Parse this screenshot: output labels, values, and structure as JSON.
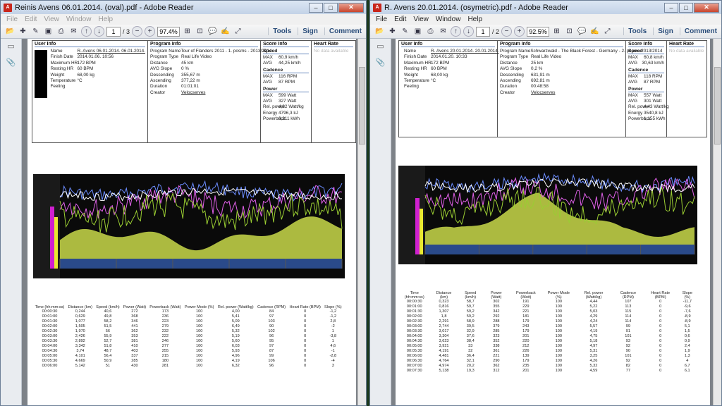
{
  "colors": {
    "chart_bg": "#0a0a0a",
    "altitude_fill": "#c9d94a",
    "power_line": "#9acd32",
    "speed_line": "#6b8cff",
    "cadence_line": "#e060e8",
    "hr_line": "#ffffff"
  },
  "left": {
    "title": "Reinis Avens 06.01.2014. (oval).pdf - Adobe Reader",
    "menu": [
      "File",
      "Edit",
      "View",
      "Window",
      "Help"
    ],
    "page_current": "1",
    "page_total": "/ 3",
    "zoom": "97.4%",
    "tools": [
      "Tools",
      "Sign",
      "Comment"
    ],
    "user": {
      "header": "User Info",
      "rows": [
        {
          "k": "Name",
          "v": "R. Avens 06.01.2014. 06.01.2014."
        },
        {
          "k": "Finish Date",
          "v": "2014.01.06. 10:56"
        },
        {
          "k": "Maximum HR",
          "v": "172 BPM"
        },
        {
          "k": "Resting HR",
          "v": "60 BPM"
        },
        {
          "k": "Weight",
          "v": "68,00 kg"
        },
        {
          "k": "Temperature",
          "v": "°C"
        },
        {
          "k": "Feeling",
          "v": ""
        }
      ]
    },
    "program": {
      "header": "Program Info",
      "rows": [
        {
          "k": "Program Name",
          "v": "Tour of Flanders 2011 - 1. posms - 2013/2014"
        },
        {
          "k": "Program Type",
          "v": "Real Life Video"
        },
        {
          "k": "Distance",
          "v": "45 km"
        },
        {
          "k": "AVG Slope",
          "v": "0 %"
        },
        {
          "k": "Descending",
          "v": "355,67 m"
        },
        {
          "k": "Ascending",
          "v": "377,22 m"
        },
        {
          "k": "Duration",
          "v": "01:01:01"
        },
        {
          "k": "",
          "v": ""
        },
        {
          "k": "Creator",
          "v": "Velocserves"
        }
      ]
    },
    "score": {
      "header": "Score Info",
      "speed_hdr": "Speed",
      "speed": [
        {
          "k": "MAX",
          "v": "60,9 km/h"
        },
        {
          "k": "AVG",
          "v": "44,25 km/h"
        }
      ],
      "cadence_hdr": "Cadence",
      "cadence": [
        {
          "k": "MAX",
          "v": "116 RPM"
        },
        {
          "k": "AVG",
          "v": "87 RPM"
        }
      ],
      "power_hdr": "Power",
      "power": [
        {
          "k": "MAX",
          "v": "599 Watt"
        },
        {
          "k": "AVG",
          "v": "327 Watt"
        },
        {
          "k": "Rel. power",
          "v": "4,82 Watt/kg"
        },
        {
          "k": "Energy",
          "v": "4796,3 kJ"
        },
        {
          "k": "Powerback",
          "v": "0,211 kWh"
        }
      ]
    },
    "heart": {
      "header": "Heart Rate",
      "faint": "No data available"
    },
    "table": {
      "headers": [
        "Time (hh:mm:ss)",
        "Distance (km)",
        "Speed (km/h)",
        "Power (Watt)",
        "Powerback (Watt)",
        "Power Mode (%)",
        "Rel. power (Watt/kg)",
        "Cadence (RPM)",
        "Heart Rate (BPM)",
        "Slope (%)"
      ],
      "rows": [
        [
          "00:00:30",
          "0,244",
          "40,6",
          "272",
          "173",
          "100",
          "4,00",
          "84",
          "0",
          "-1,2"
        ],
        [
          "00:01:00",
          "0,629",
          "49,8",
          "368",
          "236",
          "100",
          "5,41",
          "97",
          "0",
          "-1,2"
        ],
        [
          "00:01:30",
          "1,077",
          "58,2",
          "346",
          "223",
          "100",
          "5,09",
          "103",
          "0",
          "2,8"
        ],
        [
          "00:02:00",
          "1,505",
          "51,5",
          "441",
          "279",
          "100",
          "6,49",
          "90",
          "0",
          "-2"
        ],
        [
          "00:02:30",
          "1,970",
          "56",
          "362",
          "232",
          "100",
          "5,32",
          "102",
          "0",
          "1"
        ],
        [
          "00:03:00",
          "2,426",
          "55,9",
          "353",
          "222",
          "100",
          "5,19",
          "96",
          "0",
          "-3,8"
        ],
        [
          "00:03:30",
          "2,892",
          "52,7",
          "381",
          "246",
          "100",
          "5,60",
          "95",
          "0",
          "1"
        ],
        [
          "00:04:00",
          "3,342",
          "51,8",
          "410",
          "277",
          "100",
          "6,03",
          "97",
          "0",
          "4,6"
        ],
        [
          "00:04:30",
          "3,74",
          "48,7",
          "403",
          "255",
          "100",
          "5,93",
          "87",
          "0",
          "-1"
        ],
        [
          "00:05:00",
          "4,101",
          "56,4",
          "337",
          "215",
          "100",
          "4,96",
          "99",
          "0",
          "-2,8"
        ],
        [
          "00:05:30",
          "4,669",
          "50,9",
          "285",
          "180",
          "100",
          "4,19",
          "106",
          "0",
          "-4"
        ],
        [
          "00:06:00",
          "5,142",
          "51",
          "430",
          "281",
          "100",
          "6,32",
          "96",
          "0",
          "3"
        ]
      ]
    }
  },
  "right": {
    "title": "R. Avens 20.01.2014. (osymetric).pdf - Adobe Reader",
    "menu": [
      "File",
      "Edit",
      "View",
      "Window",
      "Help"
    ],
    "page_current": "1",
    "page_total": "/ 2",
    "zoom": "92.5%",
    "tools": [
      "Tools",
      "Sign",
      "Comment"
    ],
    "user": {
      "header": "User Info",
      "rows": [
        {
          "k": "Name",
          "v": "R. Avens 20.01.2014. 20.01.2014."
        },
        {
          "k": "Finish Date",
          "v": "2014.01.20. 10:33"
        },
        {
          "k": "Maximum HR",
          "v": "172 BPM"
        },
        {
          "k": "Resting HR",
          "v": "60 BPM"
        },
        {
          "k": "Weight",
          "v": "68,00 kg"
        },
        {
          "k": "Temperature",
          "v": "°C"
        },
        {
          "k": "Feeling",
          "v": ""
        }
      ]
    },
    "program": {
      "header": "Program Info",
      "rows": [
        {
          "k": "Program Name",
          "v": "Schwarzwald - The Black Forest - Germany - 2. posms 2013/2014"
        },
        {
          "k": "Program Type",
          "v": "Real Life Video"
        },
        {
          "k": "Distance",
          "v": "25 km"
        },
        {
          "k": "AVG Slope",
          "v": "0,2 %"
        },
        {
          "k": "Descending",
          "v": "631,91 m"
        },
        {
          "k": "Ascending",
          "v": "692,81 m"
        },
        {
          "k": "Duration",
          "v": "00:48:58"
        },
        {
          "k": "",
          "v": ""
        },
        {
          "k": "Creator",
          "v": "Velocserves"
        }
      ]
    },
    "score": {
      "header": "Score Info",
      "speed_hdr": "Speed",
      "speed": [
        {
          "k": "MAX",
          "v": "60,8 km/h"
        },
        {
          "k": "AVG",
          "v": "30,63 km/h"
        }
      ],
      "cadence_hdr": "Cadence",
      "cadence": [
        {
          "k": "MAX",
          "v": "118 RPM"
        },
        {
          "k": "AVG",
          "v": "87 RPM"
        }
      ],
      "power_hdr": "Power",
      "power": [
        {
          "k": "MAX",
          "v": "557 Watt"
        },
        {
          "k": "AVG",
          "v": "301 Watt"
        },
        {
          "k": "Rel. power",
          "v": "4,43 Watt/kg"
        },
        {
          "k": "Energy",
          "v": "3540,8 kJ"
        },
        {
          "k": "Powerback",
          "v": "1,155 kWh"
        }
      ]
    },
    "heart": {
      "header": "Heart Rate",
      "faint": "No data available"
    },
    "table": {
      "headers": [
        "Time (hh:mm:ss)",
        "Distance (km)",
        "Speed (km/h)",
        "Power (Watt)",
        "Powerback (Watt)",
        "Power Mode (%)",
        "Rel. power (Watt/kg)",
        "Cadence (RPM)",
        "Heart Rate (BPM)",
        "Slope (%)"
      ],
      "rows": [
        [
          "00:00:30",
          "0,323",
          "58,7",
          "302",
          "191",
          "100",
          "4,44",
          "107",
          "0",
          "-11,7"
        ],
        [
          "00:01:00",
          "0,816",
          "59,7",
          "355",
          "229",
          "100",
          "5,22",
          "113",
          "0",
          "-9,6"
        ],
        [
          "00:01:30",
          "1,307",
          "59,2",
          "342",
          "221",
          "100",
          "5,03",
          "115",
          "0",
          "-7,6"
        ],
        [
          "00:02:00",
          "1,8",
          "59,2",
          "292",
          "181",
          "100",
          "4,29",
          "114",
          "0",
          "-8,9"
        ],
        [
          "00:02:30",
          "2,291",
          "58,9",
          "288",
          "179",
          "100",
          "4,24",
          "114",
          "0",
          "-8,9"
        ],
        [
          "00:03:00",
          "2,744",
          "39,5",
          "379",
          "243",
          "100",
          "5,57",
          "99",
          "0",
          "5,1"
        ],
        [
          "00:03:30",
          "3,017",
          "32,9",
          "285",
          "179",
          "100",
          "4,19",
          "91",
          "0",
          "1,5"
        ],
        [
          "00:04:00",
          "3,304",
          "37,6",
          "323",
          "201",
          "100",
          "4,75",
          "101",
          "0",
          "0,6"
        ],
        [
          "00:04:30",
          "3,623",
          "38,4",
          "352",
          "220",
          "100",
          "5,18",
          "93",
          "0",
          "0,9"
        ],
        [
          "00:05:00",
          "3,921",
          "33",
          "338",
          "212",
          "100",
          "4,97",
          "92",
          "0",
          "2,4"
        ],
        [
          "00:05:30",
          "4,191",
          "32",
          "361",
          "226",
          "100",
          "5,31",
          "90",
          "0",
          "1,9"
        ],
        [
          "00:06:00",
          "4,481",
          "36,4",
          "221",
          "139",
          "100",
          "3,25",
          "101",
          "0",
          "1,3"
        ],
        [
          "00:06:30",
          "4,764",
          "32,1",
          "290",
          "179",
          "100",
          "4,26",
          "92",
          "0",
          "4"
        ],
        [
          "00:07:00",
          "4,974",
          "20,2",
          "362",
          "235",
          "100",
          "5,32",
          "82",
          "0",
          "6,7"
        ],
        [
          "00:07:30",
          "5,138",
          "19,3",
          "312",
          "201",
          "100",
          "4,59",
          "77",
          "0",
          "6,1"
        ]
      ]
    }
  }
}
